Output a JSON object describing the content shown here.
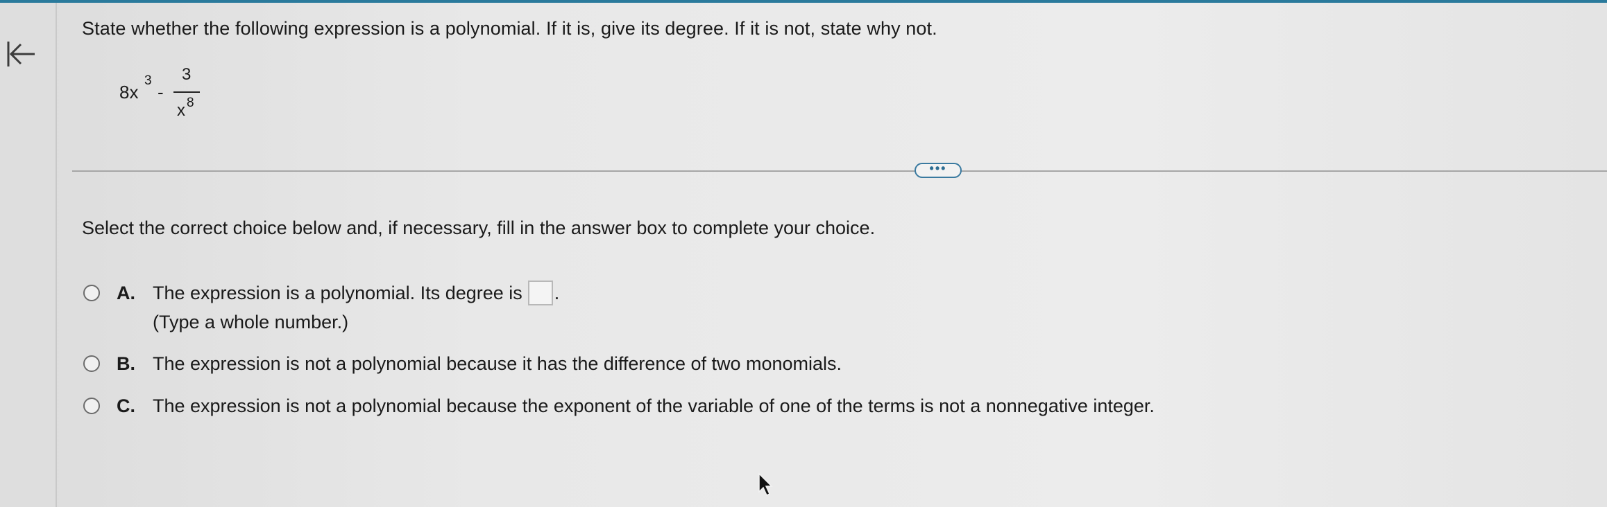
{
  "question": {
    "prompt": "State whether the following expression is a polynomial. If it is, give its degree. If it is not, state why not.",
    "expression": {
      "term1_base": "8x",
      "term1_exp": "3",
      "operator": "-",
      "numerator": "3",
      "denominator_base": "x",
      "denominator_exp": "8"
    }
  },
  "more_button": {
    "label": "•••"
  },
  "instruction": "Select the correct choice below and, if necessary, fill in the answer box to complete your choice.",
  "choices": [
    {
      "letter": "A.",
      "text": "The expression is a polynomial. Its degree is",
      "answer_value": "",
      "suffix": ".",
      "hint": "(Type a whole number.)"
    },
    {
      "letter": "B.",
      "text": "The expression is not a polynomial because it has the difference of two monomials."
    },
    {
      "letter": "C.",
      "text": "The expression is not a polynomial because the exponent of the variable of one of the terms is not a nonnegative integer."
    }
  ],
  "icons": {
    "back": "back-arrow-icon",
    "cursor": "mouse-pointer-icon"
  },
  "colors": {
    "accent": "#2a7a9c",
    "radio_border": "#6b6b6b",
    "text": "#1a1a1a"
  }
}
